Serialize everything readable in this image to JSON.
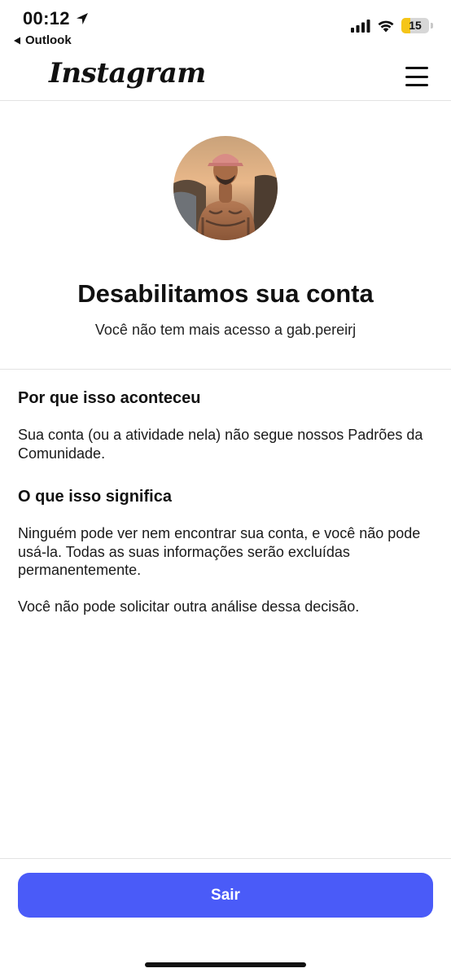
{
  "status_bar": {
    "time": "00:12",
    "back_app_label": "Outlook",
    "battery_level": "15",
    "battery_fraction": 0.15,
    "icons": [
      "location-arrow-icon",
      "cellular-signal-icon",
      "wifi-icon",
      "battery-icon"
    ]
  },
  "header": {
    "logo_text": "Instagram",
    "menu_icon": "hamburger-menu-icon"
  },
  "hero": {
    "title": "Desabilitamos sua conta",
    "subtitle": "Você não tem mais acesso a gab.pereirj"
  },
  "sections": {
    "why_title": "Por que isso aconteceu",
    "why_text": "Sua conta (ou a atividade nela) não segue nossos Padrões da Comunidade.",
    "meaning_title": "O que isso significa",
    "meaning_text_1": "Ninguém pode ver nem encontrar sua conta, e você não pode usá-la. Todas as suas informações serão excluídas permanentemente.",
    "meaning_text_2": "Você não pode solicitar outra análise dessa decisão."
  },
  "footer": {
    "logout_label": "Sair"
  },
  "colors": {
    "primary_button": "#4a5bf8",
    "battery_fill": "#f5c518",
    "divider": "#e3e3e3"
  }
}
